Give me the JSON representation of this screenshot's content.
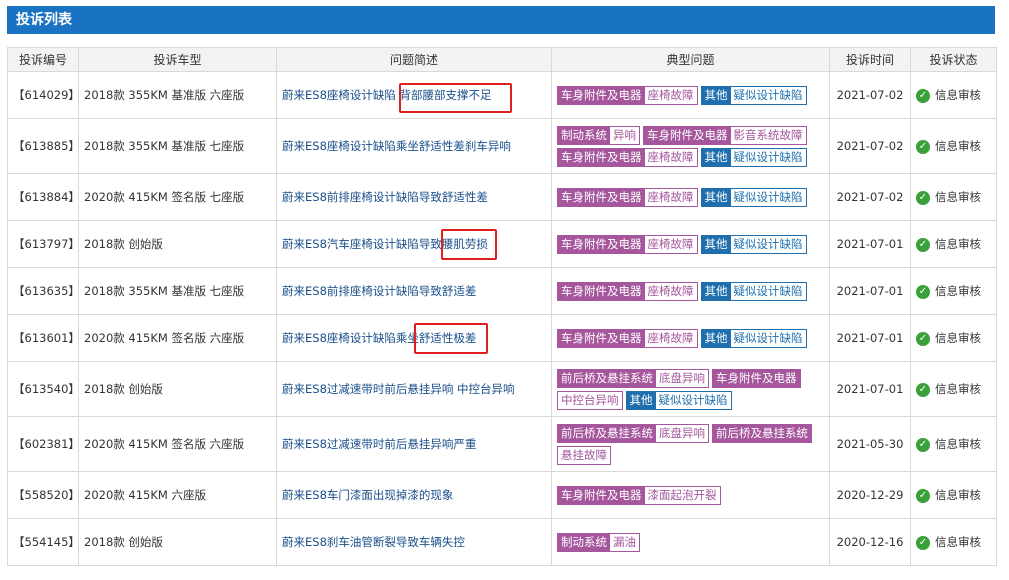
{
  "header": {
    "title": "投诉列表"
  },
  "columns": [
    "投诉编号",
    "投诉车型",
    "问题简述",
    "典型问题",
    "投诉时间",
    "投诉状态"
  ],
  "colors": {
    "title_bar": "#1a73c2",
    "tag_purple": "#a5569c",
    "tag_blue": "#1f6fae",
    "status_green": "#3aa03a",
    "highlight_red": "#e02020"
  },
  "rows": [
    {
      "id": "【614029】",
      "model": "2018款 355KM 基准版 六座版",
      "summary": "蔚来ES8座椅设计缺陷 背部腰部支撑不足",
      "tags": [
        {
          "cat": "车身附件及电器",
          "sub": "座椅故障",
          "color": "purple"
        },
        {
          "cat": "其他",
          "sub": "疑似设计缺陷",
          "color": "blue"
        }
      ],
      "date": "2021-07-02",
      "status": "信息审核"
    },
    {
      "id": "【613885】",
      "model": "2018款 355KM 基准版 七座版",
      "summary": "蔚来ES8座椅设计缺陷乘坐舒适性差刹车异响",
      "tags": [
        {
          "cat": "制动系统",
          "sub": "异响",
          "color": "purple"
        },
        {
          "cat": "车身附件及电器",
          "sub": "影音系统故障",
          "color": "purple"
        },
        {
          "cat": "车身附件及电器",
          "sub": "座椅故障",
          "color": "purple"
        },
        {
          "cat": "其他",
          "sub": "疑似设计缺陷",
          "color": "blue"
        }
      ],
      "date": "2021-07-02",
      "status": "信息审核"
    },
    {
      "id": "【613884】",
      "model": "2020款 415KM 签名版 七座版",
      "summary": "蔚来ES8前排座椅设计缺陷导致舒适性差",
      "tags": [
        {
          "cat": "车身附件及电器",
          "sub": "座椅故障",
          "color": "purple"
        },
        {
          "cat": "其他",
          "sub": "疑似设计缺陷",
          "color": "blue"
        }
      ],
      "date": "2021-07-02",
      "status": "信息审核"
    },
    {
      "id": "【613797】",
      "model": "2018款 创始版",
      "summary": "蔚来ES8汽车座椅设计缺陷导致腰肌劳损",
      "tags": [
        {
          "cat": "车身附件及电器",
          "sub": "座椅故障",
          "color": "purple"
        },
        {
          "cat": "其他",
          "sub": "疑似设计缺陷",
          "color": "blue"
        }
      ],
      "date": "2021-07-01",
      "status": "信息审核"
    },
    {
      "id": "【613635】",
      "model": "2018款 355KM 基准版 七座版",
      "summary": "蔚来ES8前排座椅设计缺陷导致舒适差",
      "tags": [
        {
          "cat": "车身附件及电器",
          "sub": "座椅故障",
          "color": "purple"
        },
        {
          "cat": "其他",
          "sub": "疑似设计缺陷",
          "color": "blue"
        }
      ],
      "date": "2021-07-01",
      "status": "信息审核"
    },
    {
      "id": "【613601】",
      "model": "2020款 415KM 签名版 六座版",
      "summary": "蔚来ES8座椅设计缺陷乘坐舒适性极差",
      "tags": [
        {
          "cat": "车身附件及电器",
          "sub": "座椅故障",
          "color": "purple"
        },
        {
          "cat": "其他",
          "sub": "疑似设计缺陷",
          "color": "blue"
        }
      ],
      "date": "2021-07-01",
      "status": "信息审核"
    },
    {
      "id": "【613540】",
      "model": "2018款 创始版",
      "summary": "蔚来ES8过减速带时前后悬挂异响 中控台异响",
      "tags": [
        {
          "cat": "前后桥及悬挂系统",
          "sub": "底盘异响",
          "color": "purple"
        },
        {
          "cat": "车身附件及电器",
          "sub": "",
          "color": "purple"
        },
        {
          "cat": "",
          "sub": "中控台异响",
          "color": "purple"
        },
        {
          "cat": "其他",
          "sub": "疑似设计缺陷",
          "color": "blue"
        }
      ],
      "date": "2021-07-01",
      "status": "信息审核"
    },
    {
      "id": "【602381】",
      "model": "2020款 415KM 签名版 六座版",
      "summary": "蔚来ES8过减速带时前后悬挂异响严重",
      "tags": [
        {
          "cat": "前后桥及悬挂系统",
          "sub": "底盘异响",
          "color": "purple"
        },
        {
          "cat": "前后桥及悬挂系统",
          "sub": "",
          "color": "purple"
        },
        {
          "cat": "",
          "sub": "悬挂故障",
          "color": "purple"
        }
      ],
      "date": "2021-05-30",
      "status": "信息审核"
    },
    {
      "id": "【558520】",
      "model": "2020款 415KM 六座版",
      "summary": "蔚来ES8车门漆面出现掉漆的现象",
      "tags": [
        {
          "cat": "车身附件及电器",
          "sub": "漆面起泡开裂",
          "color": "purple"
        }
      ],
      "date": "2020-12-29",
      "status": "信息审核"
    },
    {
      "id": "【554145】",
      "model": "2018款 创始版",
      "summary": "蔚来ES8刹车油管断裂导致车辆失控",
      "tags": [
        {
          "cat": "制动系统",
          "sub": "漏油",
          "color": "purple"
        }
      ],
      "date": "2020-12-16",
      "status": "信息审核"
    }
  ]
}
